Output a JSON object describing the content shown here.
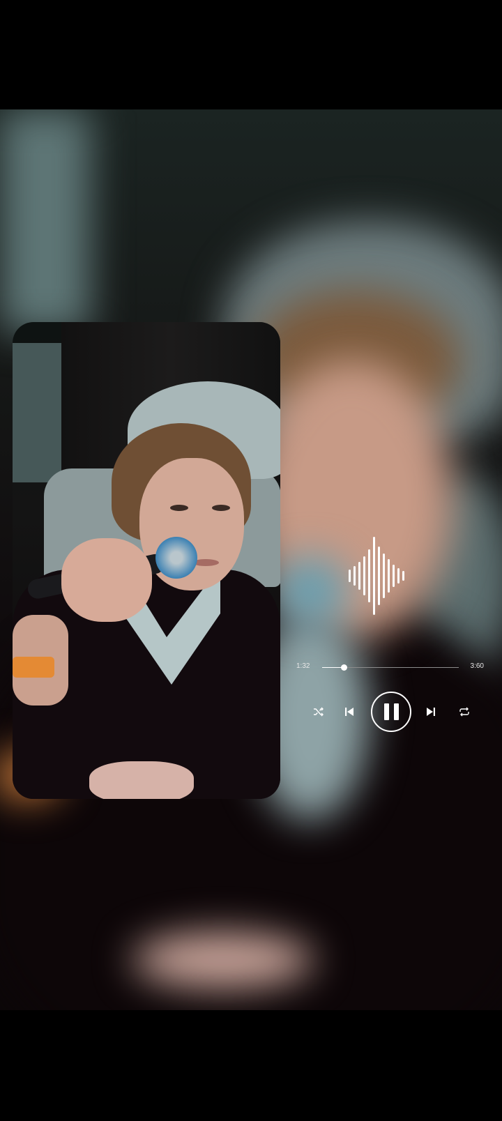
{
  "player": {
    "elapsed": "1:32",
    "total": "3:60",
    "progress": 0.16,
    "state": "playing"
  },
  "icons": {
    "waveform": "waveform-icon",
    "shuffle": "shuffle-icon",
    "previous": "previous-icon",
    "pause": "pause-icon",
    "next": "next-icon",
    "repeat": "repeat-icon"
  },
  "colors": {
    "controls": "#ffffff",
    "track": "#8c8c8c",
    "background": "#000000"
  }
}
